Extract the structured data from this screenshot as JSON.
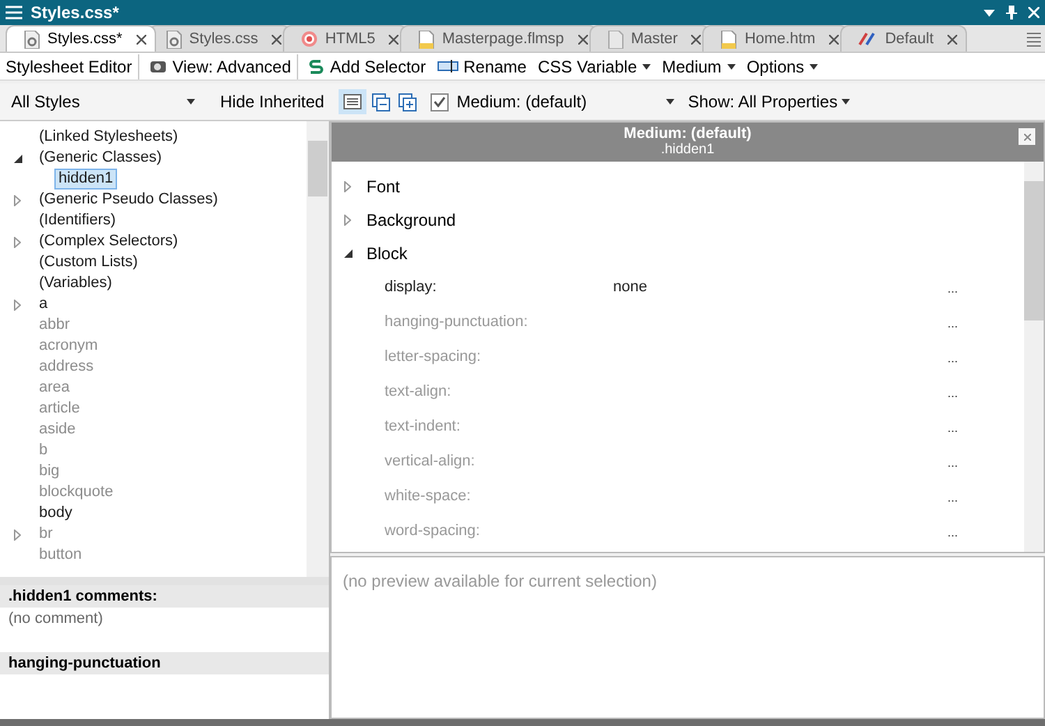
{
  "window": {
    "title": "Styles.css*"
  },
  "tabs": [
    {
      "label": "Styles.css*",
      "selected": true,
      "kind": "stylesheet"
    },
    {
      "label": "Styles.css",
      "selected": false,
      "kind": "stylesheet"
    },
    {
      "label": "HTML5",
      "selected": false,
      "kind": "target"
    },
    {
      "label": "Masterpage.flmsp",
      "selected": false,
      "kind": "page"
    },
    {
      "label": "Master",
      "selected": false,
      "kind": "plain"
    },
    {
      "label": "Home.htm",
      "selected": false,
      "kind": "page"
    },
    {
      "label": "Default",
      "selected": false,
      "kind": "skin"
    }
  ],
  "toolbar": [
    {
      "label": "Stylesheet Editor",
      "kind": "label"
    },
    {
      "label": "View: Advanced",
      "kind": "view"
    },
    {
      "label": "Add Selector",
      "kind": "add"
    },
    {
      "label": "Rename",
      "kind": "rename"
    },
    {
      "label": "CSS Variable",
      "kind": "menu"
    },
    {
      "label": "Medium",
      "kind": "menu"
    },
    {
      "label": "Options",
      "kind": "menu"
    }
  ],
  "filter_bar": {
    "style_filter": "All Styles",
    "hide_inherited": "Hide Inherited",
    "medium_checked": true,
    "medium": "Medium: (default)",
    "show": "Show: All Properties"
  },
  "tree": [
    {
      "label": "(Linked Stylesheets)",
      "defined": true,
      "selected": false
    },
    {
      "label": "(Generic Classes)",
      "defined": true,
      "selected": false,
      "expanded": true,
      "children": [
        {
          "label": "hidden1",
          "defined": true,
          "selected": true
        }
      ]
    },
    {
      "label": "(Generic Pseudo Classes)",
      "defined": true,
      "selected": false,
      "expanded": false
    },
    {
      "label": "(Identifiers)",
      "defined": true,
      "selected": false
    },
    {
      "label": "(Complex Selectors)",
      "defined": true,
      "selected": false,
      "expanded": false
    },
    {
      "label": "(Custom Lists)",
      "defined": true,
      "selected": false
    },
    {
      "label": "(Variables)",
      "defined": true,
      "selected": false
    },
    {
      "label": "a",
      "defined": true,
      "selected": false,
      "expanded": false
    },
    {
      "label": "abbr",
      "defined": false,
      "selected": false
    },
    {
      "label": "acronym",
      "defined": false,
      "selected": false
    },
    {
      "label": "address",
      "defined": false,
      "selected": false
    },
    {
      "label": "area",
      "defined": false,
      "selected": false
    },
    {
      "label": "article",
      "defined": false,
      "selected": false
    },
    {
      "label": "aside",
      "defined": false,
      "selected": false
    },
    {
      "label": "b",
      "defined": false,
      "selected": false
    },
    {
      "label": "big",
      "defined": false,
      "selected": false
    },
    {
      "label": "blockquote",
      "defined": false,
      "selected": false
    },
    {
      "label": "body",
      "defined": true,
      "selected": false
    },
    {
      "label": "br",
      "defined": false,
      "selected": false,
      "expanded": false
    },
    {
      "label": "button",
      "defined": false,
      "selected": false
    }
  ],
  "comments": {
    "title": ".hidden1 comments:",
    "text": "(no comment)"
  },
  "property_help": {
    "title": "hanging-punctuation"
  },
  "properties": {
    "title": "Medium: (default)",
    "subtitle": ".hidden1",
    "groups": [
      {
        "label": "Font",
        "expanded": false
      },
      {
        "label": "Background",
        "expanded": false
      },
      {
        "label": "Block",
        "expanded": true,
        "children": [
          {
            "name": "display:",
            "value": "none",
            "set": true,
            "action": "..."
          },
          {
            "name": "hanging-punctuation:",
            "set": false,
            "action": "..."
          },
          {
            "name": "letter-spacing:",
            "set": false,
            "action": "..."
          },
          {
            "name": "text-align:",
            "set": false,
            "action": "..."
          },
          {
            "name": "text-indent:",
            "set": false,
            "action": "..."
          },
          {
            "name": "vertical-align:",
            "set": false,
            "action": "..."
          },
          {
            "name": "white-space:",
            "set": false,
            "action": "..."
          },
          {
            "name": "word-spacing:",
            "set": false,
            "action": "..."
          }
        ]
      }
    ]
  },
  "preview": {
    "text": "(no preview available for current selection)"
  }
}
